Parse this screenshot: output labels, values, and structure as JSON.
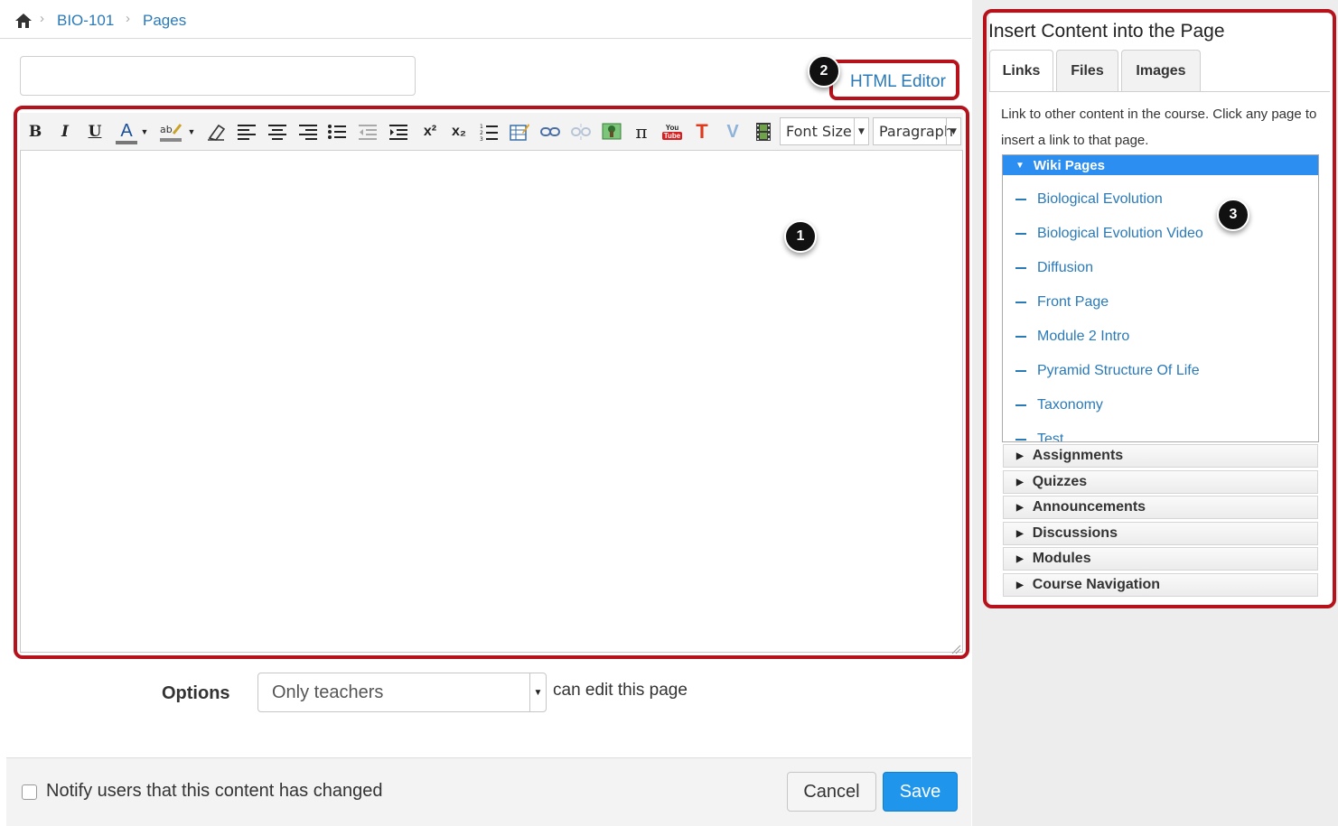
{
  "breadcrumb": {
    "items": [
      {
        "label": "BIO-101"
      },
      {
        "label": "Pages"
      }
    ]
  },
  "title_input": {
    "value": ""
  },
  "html_editor_label": "HTML Editor",
  "markers": [
    "1",
    "2",
    "3"
  ],
  "toolbar": {
    "bold": "B",
    "italic": "I",
    "underline": "U",
    "text_color": "A",
    "superscript": "x²",
    "subscript": "x₂",
    "pi": "π",
    "youtube": "You Tube",
    "t_icon": "T",
    "v_icon": "V",
    "font_size": "Font Size",
    "paragraph": "Paragraph",
    "icons": [
      "bold-icon",
      "italic-icon",
      "underline-icon",
      "text-color-icon",
      "highlight-color-icon",
      "eraser-icon",
      "align-left-icon",
      "align-center-icon",
      "align-right-icon",
      "bullet-list-icon",
      "outdent-icon",
      "indent-icon",
      "superscript-icon",
      "subscript-icon",
      "numbered-list-icon",
      "table-icon",
      "link-icon",
      "unlink-icon",
      "image-icon",
      "equation-icon",
      "youtube-icon",
      "text-icon",
      "media-icon",
      "film-icon"
    ]
  },
  "options": {
    "label": "Options",
    "selected": "Only teachers",
    "suffix": "can edit this page"
  },
  "footer": {
    "notify_label": "Notify users that this content has changed",
    "notify_checked": false,
    "cancel": "Cancel",
    "save": "Save"
  },
  "sidebar": {
    "title": "Insert Content into the Page",
    "tabs": [
      {
        "label": "Links",
        "active": true
      },
      {
        "label": "Files",
        "active": false
      },
      {
        "label": "Images",
        "active": false
      }
    ],
    "description": "Link to other content in the course. Click any page to insert a link to that page.",
    "wiki_header": "Wiki Pages",
    "wiki_pages": [
      "Biological Evolution",
      "Biological Evolution Video",
      "Diffusion",
      "Front Page",
      "Module 2 Intro",
      "Pyramid Structure Of Life",
      "Taxonomy",
      "Test"
    ],
    "sections": [
      "Assignments",
      "Quizzes",
      "Announcements",
      "Discussions",
      "Modules",
      "Course Navigation"
    ]
  },
  "colors": {
    "link": "#2a7ab8",
    "annotation_red": "#b5121b",
    "save_blue": "#1f95eb",
    "wiki_header_blue": "#2c8ef0",
    "sidebar_bg": "#ededed"
  }
}
